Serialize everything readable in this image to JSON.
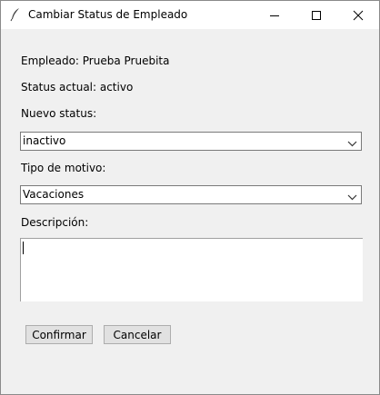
{
  "window": {
    "title": "Cambiar Status de Empleado",
    "icon": "feather-icon"
  },
  "form": {
    "employee_label": "Empleado: Prueba Pruebita",
    "current_status_label": "Status actual: activo",
    "new_status_label": "Nuevo status:",
    "new_status_value": "inactivo",
    "reason_type_label": "Tipo de motivo:",
    "reason_type_value": "Vacaciones",
    "description_label": "Descripción:",
    "description_value": ""
  },
  "buttons": {
    "confirm": "Confirmar",
    "cancel": "Cancelar"
  },
  "colors": {
    "window_bg": "#f0f0f0",
    "titlebar_bg": "#ffffff",
    "button_bg": "#e1e1e1"
  }
}
